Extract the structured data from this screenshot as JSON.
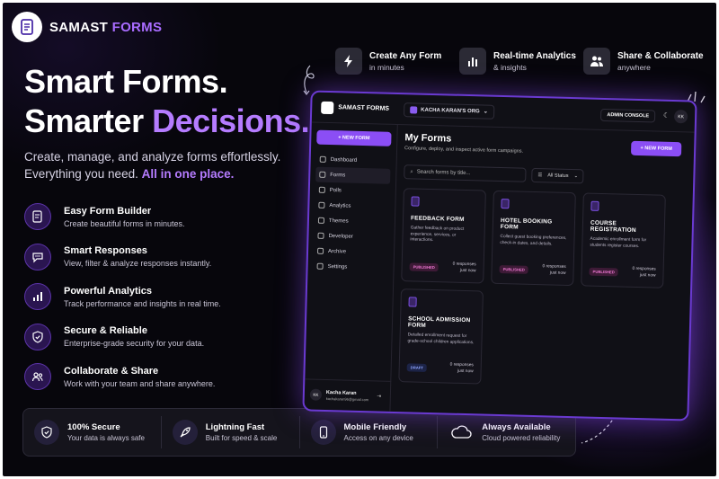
{
  "brand": {
    "name_main": "SAMAST",
    "name_accent": "FORMS"
  },
  "hero": {
    "line1": "Smart Forms.",
    "line2_plain": "Smarter ",
    "line2_accent": "Decisions.",
    "sub1": "Create, manage, and analyze forms effortlessly.",
    "sub2_plain": "Everything you need. ",
    "sub2_accent": "All in one place."
  },
  "highlights": [
    {
      "icon": "bolt-icon",
      "title": "Create Any Form",
      "sub": "in minutes"
    },
    {
      "icon": "bar-chart-icon",
      "title": "Real-time Analytics",
      "sub": "& insights"
    },
    {
      "icon": "users-icon",
      "title": "Share & Collaborate",
      "sub": "anywhere"
    }
  ],
  "features": [
    {
      "icon": "form-edit-icon",
      "title": "Easy Form Builder",
      "desc": "Create beautiful forms in minutes."
    },
    {
      "icon": "chat-bubble-icon",
      "title": "Smart Responses",
      "desc": "View, filter & analyze responses instantly."
    },
    {
      "icon": "analytics-icon",
      "title": "Powerful Analytics",
      "desc": "Track performance and insights in real time."
    },
    {
      "icon": "shield-icon",
      "title": "Secure & Reliable",
      "desc": "Enterprise-grade security for your data."
    },
    {
      "icon": "team-icon",
      "title": "Collaborate & Share",
      "desc": "Work with your team and share anywhere."
    }
  ],
  "strip": [
    {
      "icon": "shield-check-icon",
      "title": "100% Secure",
      "sub": "Your data is always safe"
    },
    {
      "icon": "rocket-icon",
      "title": "Lightning Fast",
      "sub": "Built for speed & scale"
    },
    {
      "icon": "mobile-icon",
      "title": "Mobile Friendly",
      "sub": "Access on any device"
    },
    {
      "icon": "cloud-icon",
      "title": "Always Available",
      "sub": "Cloud powered reliability"
    }
  ],
  "app": {
    "brand": "SAMAST FORMS",
    "org": "KACHA KARAN'S ORG",
    "admin": "ADMIN CONSOLE",
    "avatar": "KK",
    "new_form": "+ NEW FORM",
    "nav": [
      "Dashboard",
      "Forms",
      "Polls",
      "Analytics",
      "Themes",
      "Developer",
      "Archive",
      "Settings"
    ],
    "user": {
      "name": "Kacha Karan",
      "email": "kachakaran96@gmail.com"
    },
    "main_title": "My Forms",
    "main_sub": "Configure, deploy, and inspect active form campaigns.",
    "search_placeholder": "Search forms by title...",
    "status": "All Status",
    "cards": [
      {
        "title": "FEEDBACK FORM",
        "desc": "Gather feedback on product experience, services, or interactions.",
        "badge": "PUBLISHED",
        "responses": "0 responses",
        "time": "just now"
      },
      {
        "title": "HOTEL BOOKING FORM",
        "desc": "Collect guest booking preferences, check-in dates, and details.",
        "badge": "PUBLISHED",
        "responses": "0 responses",
        "time": "just now"
      },
      {
        "title": "COURSE REGISTRATION",
        "desc": "Academic enrollment form for students register courses.",
        "badge": "PUBLISHED",
        "responses": "0 responses",
        "time": "just now"
      },
      {
        "title": "SCHOOL ADMISSION FORM",
        "desc": "Detailed enrollment request for grade-school children applications.",
        "badge": "DRAFT",
        "responses": "0 responses",
        "time": "just now"
      }
    ]
  }
}
